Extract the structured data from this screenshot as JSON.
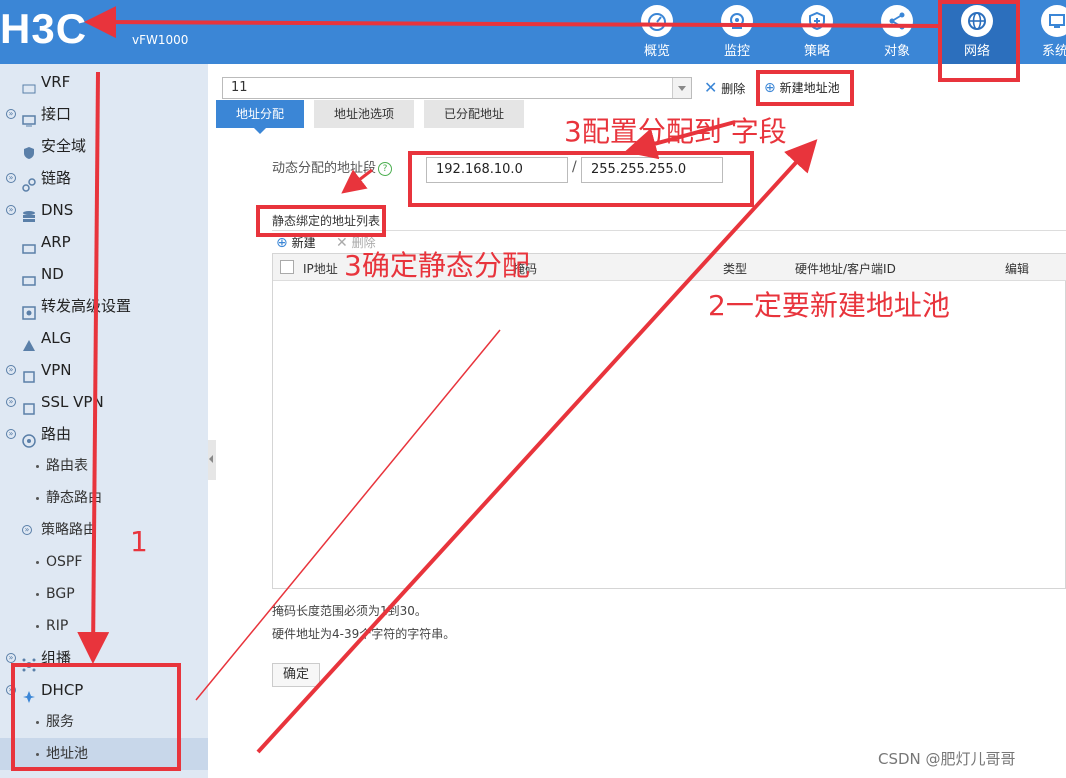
{
  "header": {
    "logo": "H3C",
    "model": "vFW1000",
    "nav": [
      {
        "label": "概览",
        "icon": "dashboard-icon"
      },
      {
        "label": "监控",
        "icon": "monitor-icon"
      },
      {
        "label": "策略",
        "icon": "shield-plus-icon"
      },
      {
        "label": "对象",
        "icon": "share-icon"
      },
      {
        "label": "网络",
        "icon": "globe-icon",
        "active": true
      },
      {
        "label": "系统",
        "icon": "system-icon"
      }
    ]
  },
  "sidebar": {
    "items": [
      {
        "label": "VRF"
      },
      {
        "label": "接口"
      },
      {
        "label": "安全域"
      },
      {
        "label": "链路"
      },
      {
        "label": "DNS"
      },
      {
        "label": "ARP"
      },
      {
        "label": "ND"
      },
      {
        "label": "转发高级设置"
      },
      {
        "label": "ALG"
      },
      {
        "label": "VPN"
      },
      {
        "label": "SSL VPN"
      },
      {
        "label": "路由"
      },
      {
        "label": "路由表"
      },
      {
        "label": "静态路由"
      },
      {
        "label": "策略路由"
      },
      {
        "label": "OSPF"
      },
      {
        "label": "BGP"
      },
      {
        "label": "RIP"
      },
      {
        "label": "组播"
      },
      {
        "label": "DHCP"
      },
      {
        "label": "服务"
      },
      {
        "label": "地址池"
      }
    ]
  },
  "main": {
    "pool_select_value": "11",
    "delete_label": "删除",
    "new_pool_label": "新建地址池",
    "tabs": [
      {
        "label": "地址分配"
      },
      {
        "label": "地址池选项"
      },
      {
        "label": "已分配地址"
      }
    ],
    "dynamic_label": "动态分配的地址段",
    "dynamic_ip": "192.168.10.0",
    "dynamic_mask": "255.255.255.0",
    "slash": "/",
    "static_title": "静态绑定的地址列表",
    "new_label": "新建",
    "remove_label": "删除",
    "columns": {
      "ip": "IP地址",
      "mask": "掩码",
      "type": "类型",
      "hw": "硬件地址/客户端ID",
      "edit": "编辑"
    },
    "note1": "掩码长度范围必须为1到30。",
    "note2": "硬件地址为4-39个字符的字符串。",
    "ok_label": "确定"
  },
  "annotations": {
    "a1": "1",
    "a2": "2一定要新建地址池",
    "a3a": "3配置分配到 字段",
    "a3b": "3确定静态分配"
  },
  "watermark": "CSDN @肥灯儿哥哥",
  "colors": {
    "header": "#3b86d6",
    "annotation": "#e8343c",
    "sidebar": "#dfe8f3"
  }
}
